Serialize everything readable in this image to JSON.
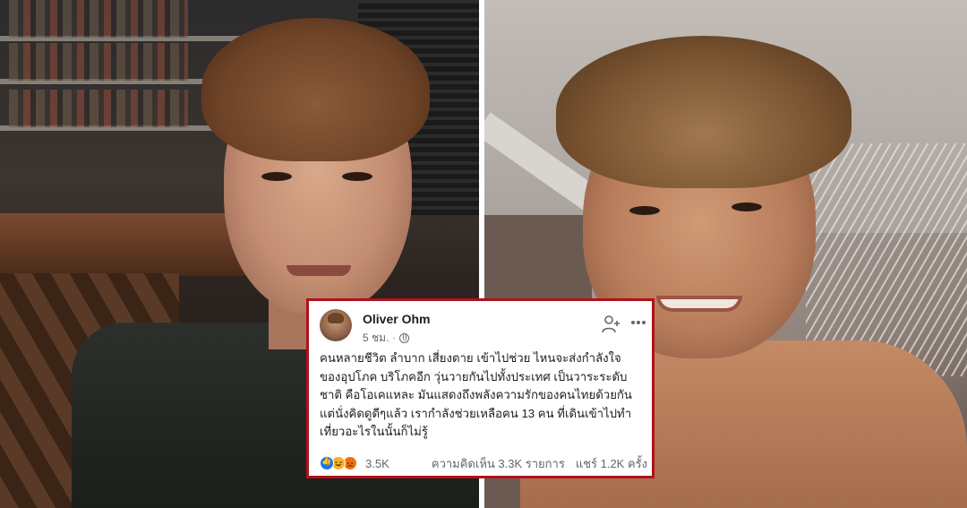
{
  "post": {
    "author": "Oliver Ohm",
    "time": "5 ชม.",
    "separator": "·",
    "body_lines": [
      "คนหลายชีวิต ลำบาก เสี่ยงตาย เข้าไปช่วย ไหนจะส่งกำลังใจ",
      "ของอุปโภค บริโภคอีก วุ่นวายกันไปทั้งประเทศ เป็นวาระระดับ",
      "ชาติ คือโอเคแหละ มันแสดงถึงพลังความรักของคนไทยด้วยกัน",
      "แต่นั่งคิดดูดีๆแล้ว เรากำลังช่วยเหลือคน 13 คน ที่เดินเข้าไปทำ",
      "เที่ยวอะไรในนั้นก็ไม่รู้"
    ],
    "reaction_count": "3.5K",
    "comments": "ความคิดเห็น 3.3K รายการ",
    "shares": "แชร์ 1.2K ครั้ง"
  },
  "icons": {
    "privacy": "globe-icon",
    "add_friend": "add-friend-icon",
    "more": "more-icon",
    "reactions": [
      "like-icon",
      "haha-icon",
      "angry-icon"
    ]
  },
  "colors": {
    "card_border": "#b0121b",
    "like_blue": "#1877f2",
    "haha_yellow": "#f7b125",
    "angry_orange": "#e9710f",
    "meta_gray": "#606770"
  }
}
